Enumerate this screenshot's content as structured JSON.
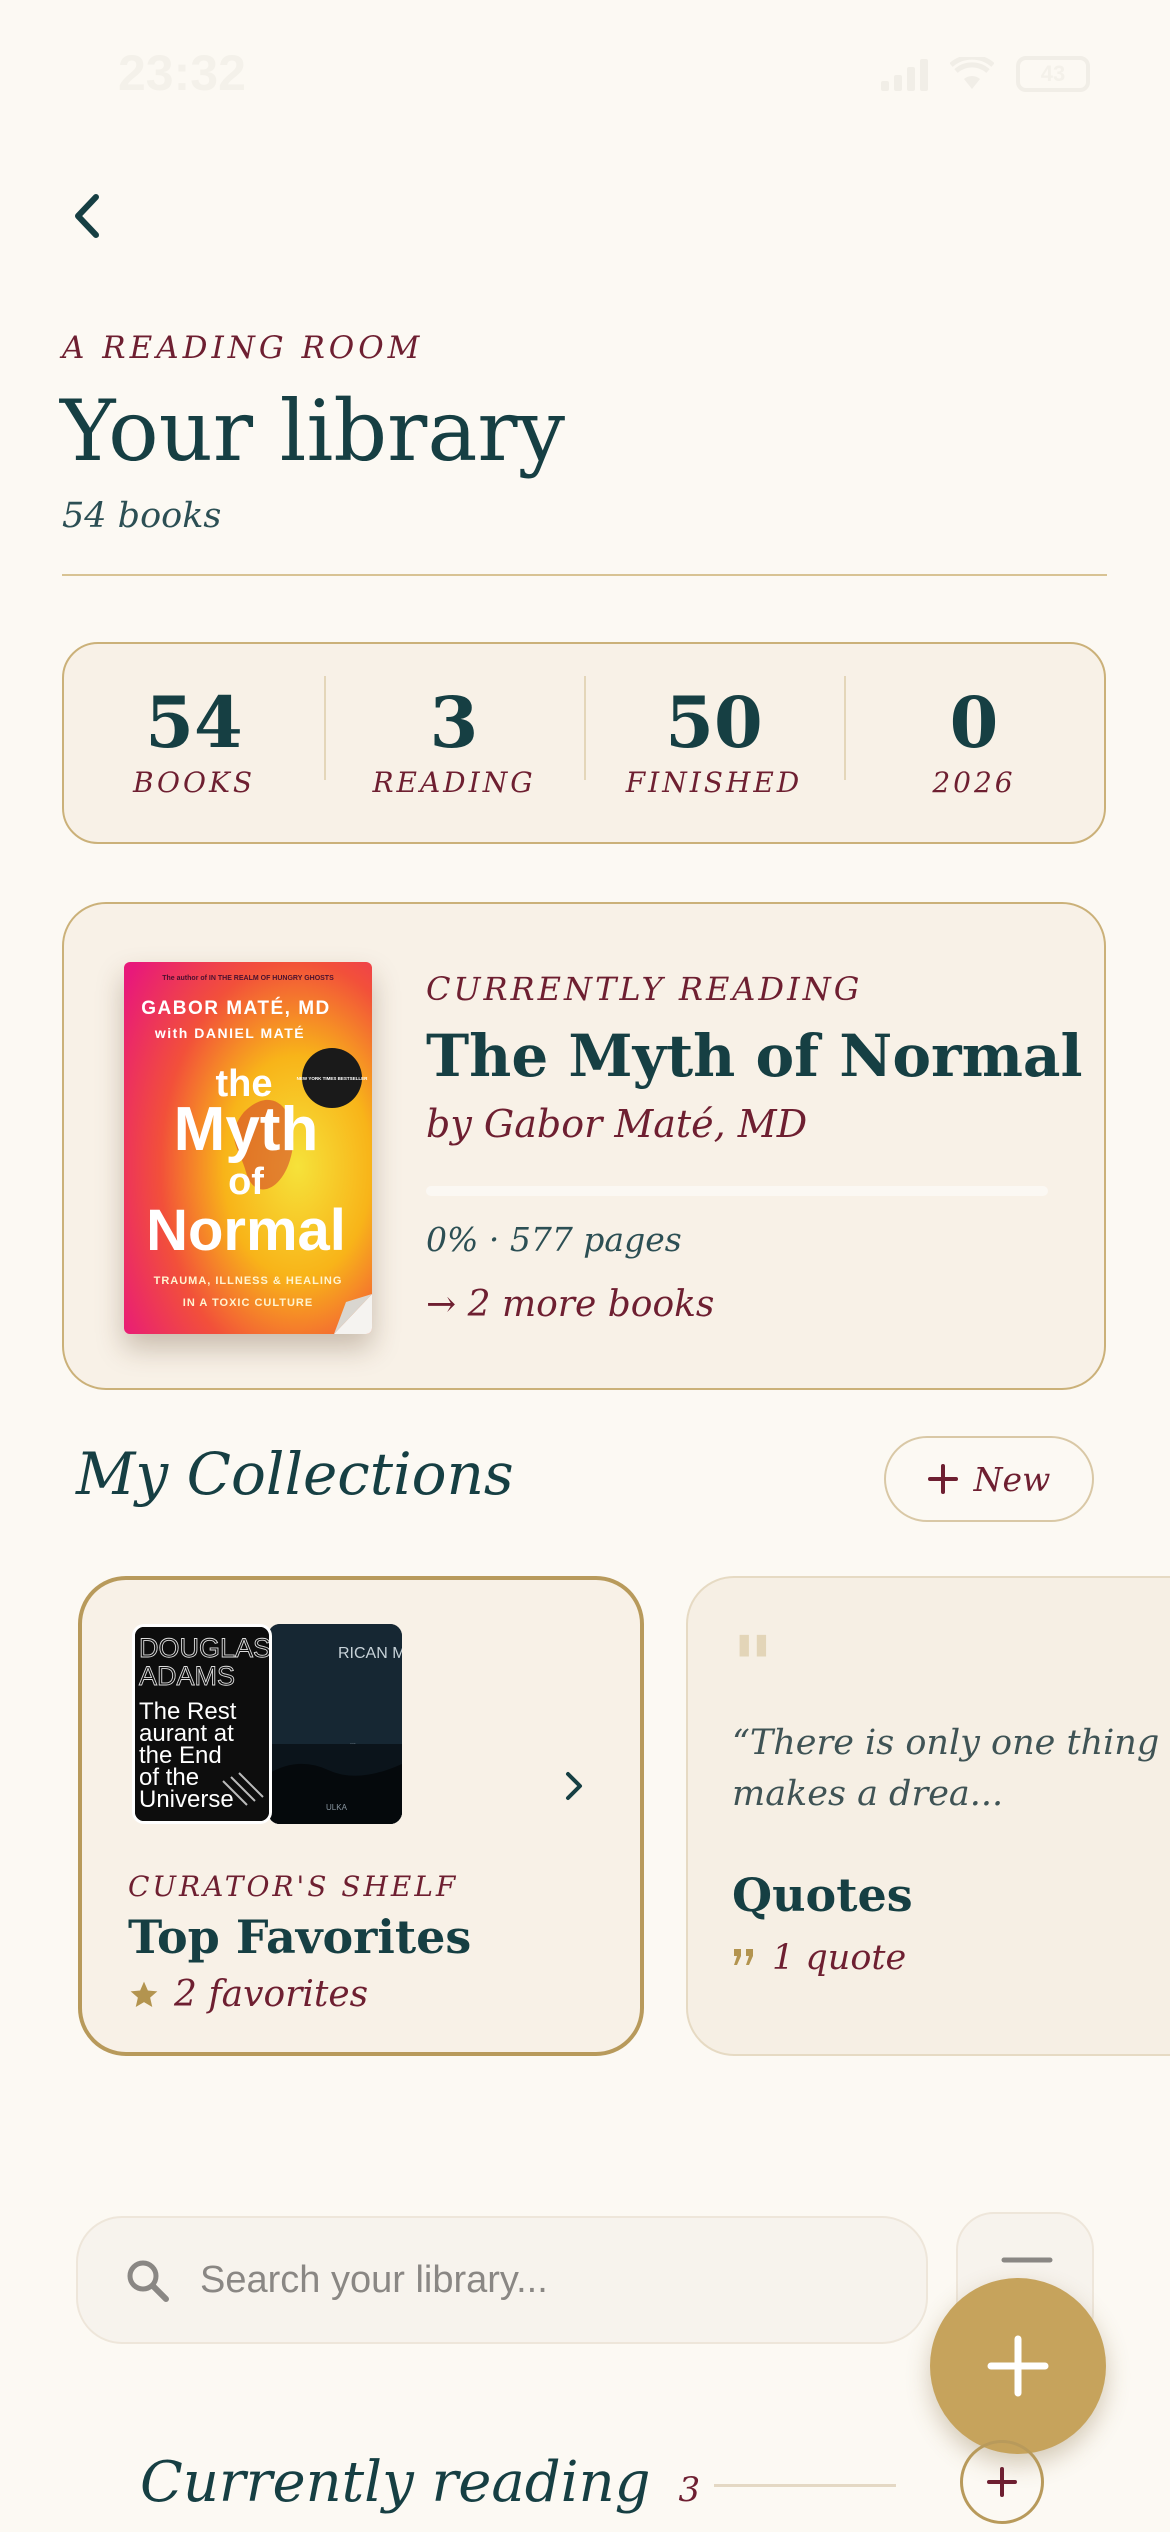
{
  "status": {
    "time": "23:32",
    "battery": "43"
  },
  "header": {
    "eyebrow": "A READING ROOM",
    "title": "Your library",
    "count": "54 books"
  },
  "stats": [
    {
      "value": "54",
      "label": "BOOKS"
    },
    {
      "value": "3",
      "label": "READING"
    },
    {
      "value": "50",
      "label": "FINISHED"
    },
    {
      "value": "0",
      "label": "2026"
    }
  ],
  "current": {
    "eyebrow": "CURRENTLY READING",
    "title": "The Myth of Normal",
    "author": "by Gabor Maté, MD",
    "progress": 0,
    "meta": "0% · 577 pages",
    "more": "→ 2 more books",
    "cover": {
      "top_line": "The author of IN THE REALM OF HUNGRY GHOSTS",
      "author1": "GABOR MATÉ, MD",
      "author2": "with DANIEL MATÉ",
      "badge": "NEW YORK TIMES BESTSELLER",
      "the": "the",
      "myth": "Myth",
      "of": "of",
      "normal": "Normal",
      "tagline1": "TRAUMA, ILLNESS & HEALING",
      "tagline2": "IN A TOXIC CULTURE"
    }
  },
  "collections": {
    "heading": "My Collections",
    "new_label": "New",
    "items": [
      {
        "eyebrow": "CURATOR'S SHELF",
        "title": "Top Favorites",
        "sub": "2 favorites",
        "book1": {
          "author": "DOUGLAS ADAMS",
          "title": "The Restaurant at the End of the Universe"
        },
        "book2": {
          "top": "RICAN MIC",
          "mid": "...",
          "bottom": "ULKA"
        }
      },
      {
        "quote": "“There is only one thing that makes a drea...",
        "title": "Quotes",
        "sub": "1 quote"
      }
    ]
  },
  "search": {
    "placeholder": "Search your library..."
  },
  "currently_reading": {
    "title": "Currently reading",
    "count": "3"
  },
  "colors": {
    "background": "#fcf9f3",
    "teal": "#163f43",
    "burgundy": "#6e1f31",
    "gold": "#c6a35c"
  }
}
